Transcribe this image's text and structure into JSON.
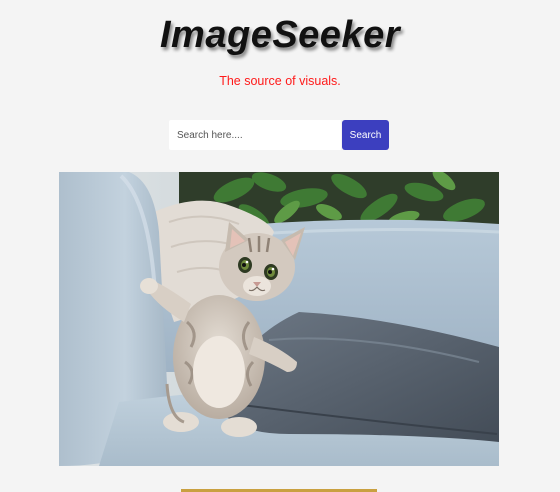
{
  "header": {
    "title": "ImageSeeker",
    "tagline": "The source of visuals."
  },
  "search": {
    "placeholder": "Search here....",
    "value": "",
    "button_label": "Search"
  },
  "result": {
    "image_subject": "kitten-on-sofa"
  },
  "colors": {
    "accent": "#3c3fbf",
    "tagline": "#ff1a1a",
    "background": "#f4f4f4"
  }
}
